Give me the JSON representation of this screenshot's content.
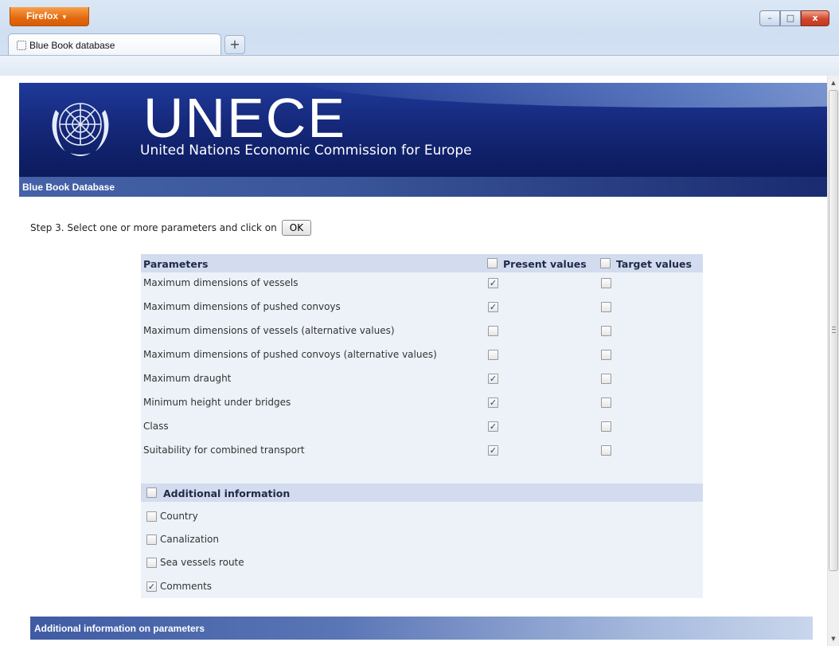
{
  "browser": {
    "app_button_label": "Firefox",
    "tab_title": "Blue Book database",
    "new_tab_symbol": "+",
    "window_buttons": {
      "minimize": "–",
      "maximize": "□",
      "close": "x"
    }
  },
  "banner": {
    "logo_text": "UNECE",
    "tagline": "United Nations Economic Commission for Europe",
    "emblem_icon": "un-emblem-icon",
    "section_title": "Blue Book Database"
  },
  "step": {
    "instruction": "Step 3. Select one or more parameters and click on",
    "ok_label": "OK"
  },
  "table": {
    "header": {
      "parameters": "Parameters",
      "present_values": "Present values",
      "target_values": "Target values",
      "present_all_checked": false,
      "target_all_checked": false
    },
    "rows": [
      {
        "label": "Maximum dimensions of vessels",
        "present": true,
        "target": false
      },
      {
        "label": "Maximum dimensions of pushed convoys",
        "present": true,
        "target": false
      },
      {
        "label": "Maximum dimensions of vessels (alternative values)",
        "present": false,
        "target": false
      },
      {
        "label": "Maximum dimensions of pushed convoys (alternative values)",
        "present": false,
        "target": false
      },
      {
        "label": "Maximum draught",
        "present": true,
        "target": false
      },
      {
        "label": "Minimum height under bridges",
        "present": true,
        "target": false
      },
      {
        "label": "Class",
        "present": true,
        "target": false
      },
      {
        "label": "Suitability for combined transport",
        "present": true,
        "target": false
      }
    ],
    "additional": {
      "title": "Additional information",
      "all_checked": false,
      "items": [
        {
          "label": "Country",
          "checked": false
        },
        {
          "label": "Canalization",
          "checked": false
        },
        {
          "label": "Sea vessels route",
          "checked": false
        },
        {
          "label": "Comments",
          "checked": true
        }
      ]
    }
  },
  "footer_bar": {
    "title": "Additional information on parameters"
  },
  "colors": {
    "banner_blue": "#15287a",
    "table_header": "#d3dcee",
    "table_body": "#edf2f9",
    "firefox_orange": "#e3690e"
  }
}
